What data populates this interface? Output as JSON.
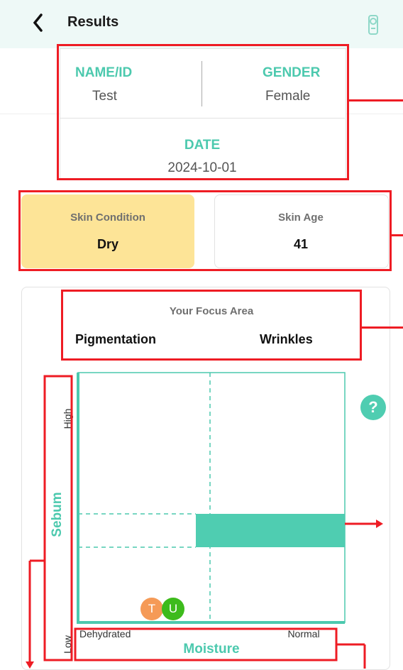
{
  "header": {
    "title": "Results"
  },
  "profile": {
    "name_label": "NAME/ID",
    "name_value": "Test",
    "gender_label": "GENDER",
    "gender_value": "Female",
    "date_label": "DATE",
    "date_value": "2024-10-01"
  },
  "skin": {
    "condition_label": "Skin Condition",
    "condition_value": "Dry",
    "age_label": "Skin Age",
    "age_value": "41"
  },
  "focus": {
    "title": "Your Focus Area",
    "items": [
      "Pigmentation",
      "Wrinkles"
    ]
  },
  "help": {
    "label": "?"
  },
  "chart_data": {
    "type": "scatter",
    "xlabel": "Moisture",
    "ylabel": "Sebum",
    "x_tick_labels": [
      "Dehydrated",
      "Normal"
    ],
    "y_tick_labels": [
      "Low",
      "High"
    ],
    "highlight_band": {
      "x_range": [
        "middle",
        "Normal"
      ],
      "y_range": [
        "lower-middle",
        "middle"
      ]
    },
    "points": [
      {
        "label": "T",
        "x": "Dehydrated",
        "y": "Low",
        "color": "#f59a57"
      },
      {
        "label": "U",
        "x": "Dehydrated",
        "y": "Low",
        "color": "#3dbb1c"
      }
    ],
    "accent_color": "#4cc9ae"
  }
}
